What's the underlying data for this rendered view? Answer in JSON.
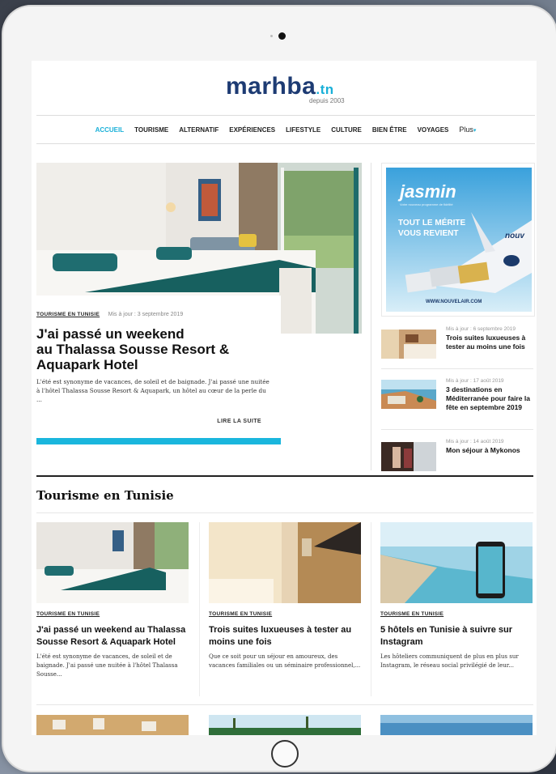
{
  "site": {
    "logo_main": "marhba",
    "logo_ext": ".tn",
    "logo_sub": "depuis 2003"
  },
  "nav": {
    "items": [
      "ACCUEIL",
      "TOURISME",
      "ALTERNATIF",
      "EXPÉRIENCES",
      "LIFESTYLE",
      "CULTURE",
      "BIEN ÊTRE",
      "VOYAGES"
    ],
    "more": "Plus",
    "active_color": "#1ab0d8"
  },
  "hero": {
    "category": "TOURISME EN TUNISIE",
    "date": "Mis à jour : 3 septembre 2019",
    "title_lines": [
      "J'ai passé un weekend",
      "au Thalassa Sousse Resort &",
      "Aquapark Hotel"
    ],
    "excerpt": "L'été est synonyme de vacances, de soleil et de baignade. J'ai passé une nuitée à l'hôtel Thalassa Sousse Resort & Aquapark, un hôtel au cœur de la perle du ...",
    "read_more": "LIRE LA SUITE",
    "accent": "#1ab6dd"
  },
  "ad": {
    "brand": "jasmin",
    "tagline": "Votre nouveau programme de fidélité",
    "headline_1": "TOUT LE MÉRITE",
    "headline_2": "VOUS REVIENT",
    "plane_text": "nouv",
    "url": "WWW.NOUVELAIR.COM"
  },
  "sidebar": [
    {
      "date": "Mis à jour : 6 septembre 2019",
      "title": "Trois suites luxueuses à tester au moins une fois"
    },
    {
      "date": "Mis à jour : 17 août 2019",
      "title": "3 destinations en Méditerranée pour faire la fête en septembre 2019"
    },
    {
      "date": "Mis à jour : 14 août 2019",
      "title": "Mon séjour à Mykonos"
    }
  ],
  "section": {
    "title": "Tourisme en Tunisie",
    "cards": [
      {
        "category": "TOURISME EN TUNISIE",
        "title": "J'ai passé un weekend au Thalassa Sousse Resort & Aquapark Hotel",
        "excerpt": "L'été est synonyme de vacances, de soleil et de baignade. J'ai passé une nuitée à l'hôtel Thalassa Sousse..."
      },
      {
        "category": "TOURISME EN TUNISIE",
        "title": "Trois suites luxueuses à tester au moins une fois",
        "excerpt": "Que ce soit pour un séjour en amoureux, des vacances familiales ou un séminaire professionnel,..."
      },
      {
        "category": "TOURISME EN TUNISIE",
        "title": "5 hôtels en Tunisie à suivre sur Instagram",
        "excerpt": "Les hôteliers communiquent de plus en plus sur Instagram, le réseau social privilégié de leur..."
      }
    ]
  }
}
